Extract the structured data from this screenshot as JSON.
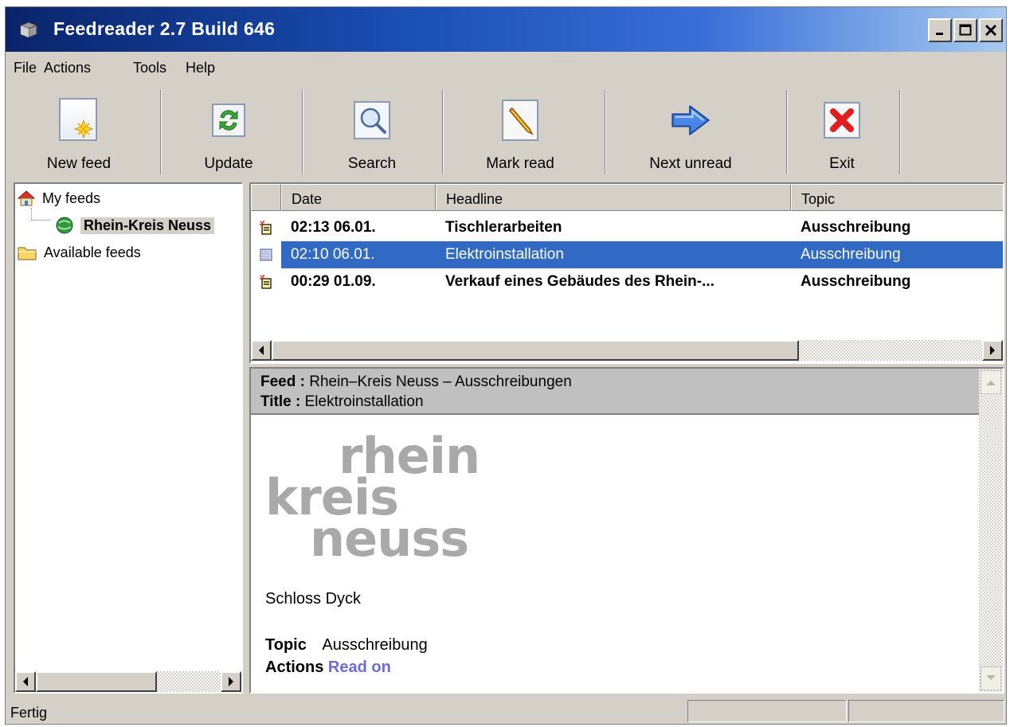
{
  "window": {
    "title": "Feedreader 2.7 Build 646"
  },
  "menu": [
    {
      "label": "File"
    },
    {
      "label": "Actions"
    },
    {
      "label": "Tools"
    },
    {
      "label": "Help"
    }
  ],
  "toolbar": {
    "new_feed": "New feed",
    "update": "Update",
    "search": "Search",
    "mark_read": "Mark read",
    "next_unread": "Next unread",
    "exit": "Exit"
  },
  "tree": {
    "root": "My feeds",
    "feed": "Rhein-Kreis Neuss",
    "available": "Available feeds"
  },
  "list": {
    "columns": {
      "date": "Date",
      "headline": "Headline",
      "topic": "Topic"
    },
    "rows": [
      {
        "date": "02:13 06.01.",
        "headline": "Tischlerarbeiten",
        "topic": "Ausschreibung",
        "unread": true
      },
      {
        "date": "02:10 06.01.",
        "headline": "Elektroinstallation",
        "topic": "Ausschreibung",
        "unread": false,
        "selected": true
      },
      {
        "date": "00:29 01.09.",
        "headline": "Verkauf eines Gebäudes des Rhein-...",
        "topic": "Ausschreibung",
        "unread": true
      }
    ]
  },
  "preview": {
    "feed_label": "Feed :",
    "feed_value": "Rhein–Kreis Neuss – Ausschreibungen",
    "title_label": "Title :",
    "title_value": "Elektroinstallation",
    "logo": {
      "line1": "rhein",
      "line2": "kreis",
      "line3": "neuss"
    },
    "body_text": "Schloss Dyck",
    "topic_label": "Topic",
    "topic_value": "Ausschreibung",
    "actions_label": "Actions",
    "actions_link": "Read on"
  },
  "status": {
    "text": "Fertig"
  },
  "colors": {
    "title_bar": "#0a246a",
    "selection": "#316ac5",
    "link": "#6b6bd8",
    "logo_gray": "#a9a9a9"
  }
}
